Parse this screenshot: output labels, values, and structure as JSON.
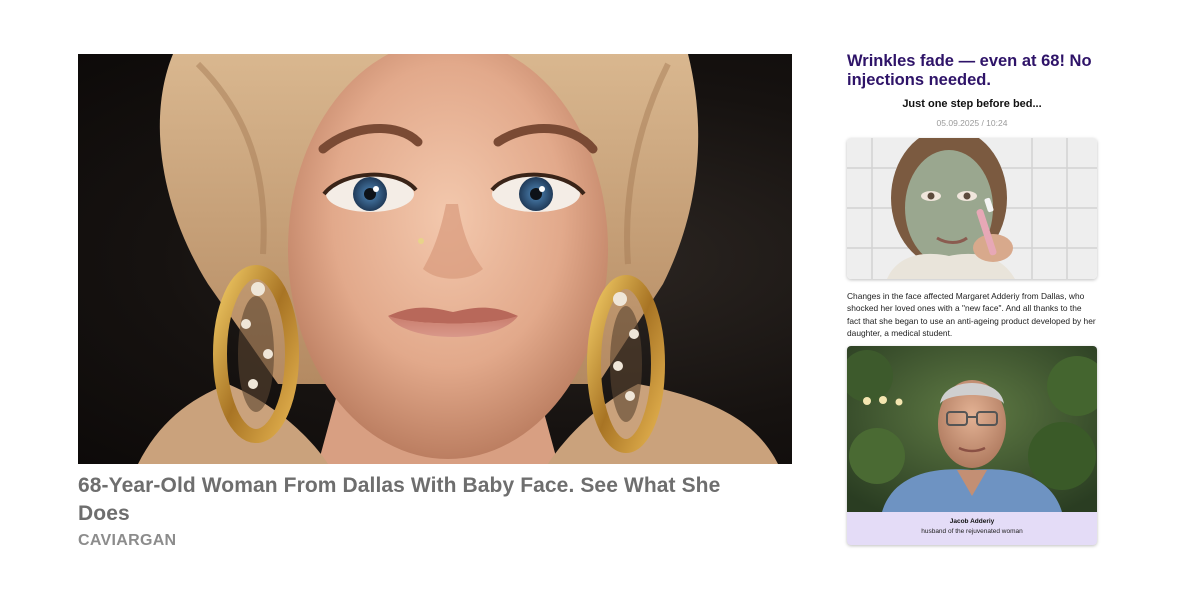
{
  "ad": {
    "title": "68-Year-Old Woman From Dallas With Baby Face. See What She Does",
    "brand": "CAVIARGAN"
  },
  "article": {
    "headline": "Wrinkles fade — even at 68! No injections needed.",
    "subheadline": "Just one step before bed...",
    "date": "05.09.2025 / 10:24",
    "body": "Changes in the face affected Margaret Adderiy from Dallas, who shocked her loved ones with a \"new face\". And all thanks to the fact that she began to use an anti-ageing product developed by her daughter, a medical student.",
    "caption_name": "Jacob Adderiy",
    "caption_role": "husband of the rejuvenated woman"
  },
  "colors": {
    "headline": "#2e1368",
    "caption_bg": "#e4dcf7",
    "ad_title": "#6e6e6e",
    "brand": "#8c8c8c"
  }
}
